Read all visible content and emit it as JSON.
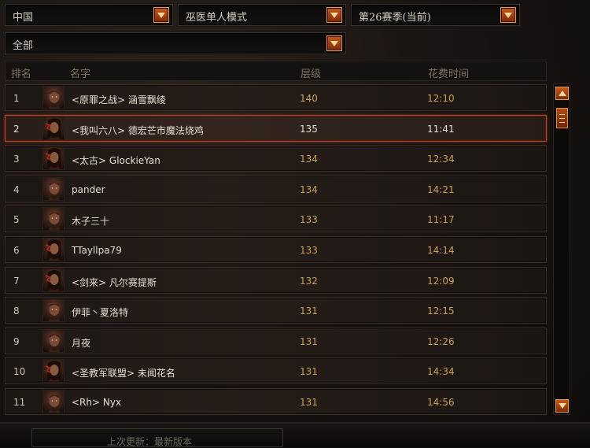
{
  "filters": {
    "region": "中国",
    "mode": "巫医单人模式",
    "season": "第26赛季(当前)",
    "category": "全部"
  },
  "columns": {
    "rank": "排名",
    "name": "名字",
    "tier": "层级",
    "time": "花费时间"
  },
  "rows": [
    {
      "rank": "1",
      "name": "<原罪之战> 涵雪飘绫",
      "tier": "140",
      "time": "12:10",
      "portrait": "male"
    },
    {
      "rank": "2",
      "name": "<我叫六八> 德宏芒市魔法烧鸡",
      "tier": "135",
      "time": "11:41",
      "portrait": "female"
    },
    {
      "rank": "3",
      "name": "<太古> GlockieYan",
      "tier": "134",
      "time": "12:34",
      "portrait": "female"
    },
    {
      "rank": "4",
      "name": "pander",
      "tier": "134",
      "time": "14:21",
      "portrait": "male"
    },
    {
      "rank": "5",
      "name": "木子三十",
      "tier": "133",
      "time": "11:17",
      "portrait": "male"
    },
    {
      "rank": "6",
      "name": "TTayllpa79",
      "tier": "133",
      "time": "14:14",
      "portrait": "female"
    },
    {
      "rank": "7",
      "name": "<剑来> 凡尔赛提斯",
      "tier": "132",
      "time": "12:09",
      "portrait": "female"
    },
    {
      "rank": "8",
      "name": "伊菲丶夏洛特",
      "tier": "131",
      "time": "12:15",
      "portrait": "male"
    },
    {
      "rank": "9",
      "name": "月夜",
      "tier": "131",
      "time": "12:26",
      "portrait": "male"
    },
    {
      "rank": "10",
      "name": "<圣教军联盟> 未闻花名",
      "tier": "131",
      "time": "14:34",
      "portrait": "female"
    },
    {
      "rank": "11",
      "name": "<Rh> Nyx",
      "tier": "131",
      "time": "14:56",
      "portrait": "male"
    }
  ],
  "selected_rank": "2",
  "footer": {
    "last_update": "上次更新：最新版本"
  },
  "colors": {
    "accent": "#c55a17",
    "value_gold": "#c9a259",
    "selected_border": "#b2472a"
  }
}
